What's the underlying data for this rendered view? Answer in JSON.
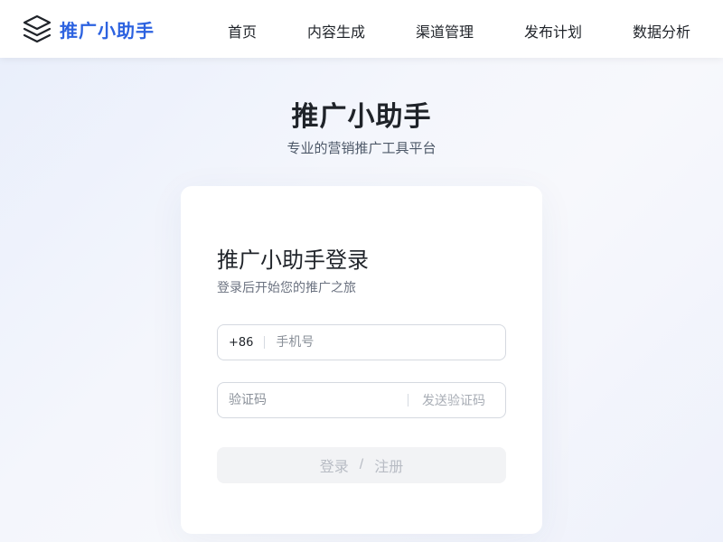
{
  "header": {
    "brand_name": "推广小助手",
    "nav": [
      "首页",
      "内容生成",
      "渠道管理",
      "发布计划",
      "数据分析"
    ]
  },
  "hero": {
    "title": "推广小助手",
    "subtitle": "专业的营销推广工具平台"
  },
  "login": {
    "title": "推广小助手登录",
    "subtitle": "登录后开始您的推广之旅",
    "phone_prefix": "+86",
    "phone_placeholder": "手机号",
    "code_placeholder": "验证码",
    "send_code_label": "发送验证码",
    "submit_login": "登录",
    "submit_separator": "/",
    "submit_register": "注册"
  },
  "colors": {
    "brand": "#2c62e0",
    "text_primary": "#1f2329",
    "text_secondary": "#6b7280",
    "button_disabled_bg": "#f2f3f5",
    "button_disabled_text": "#b8bcc4"
  },
  "icons": {
    "brand": "layers-icon"
  }
}
